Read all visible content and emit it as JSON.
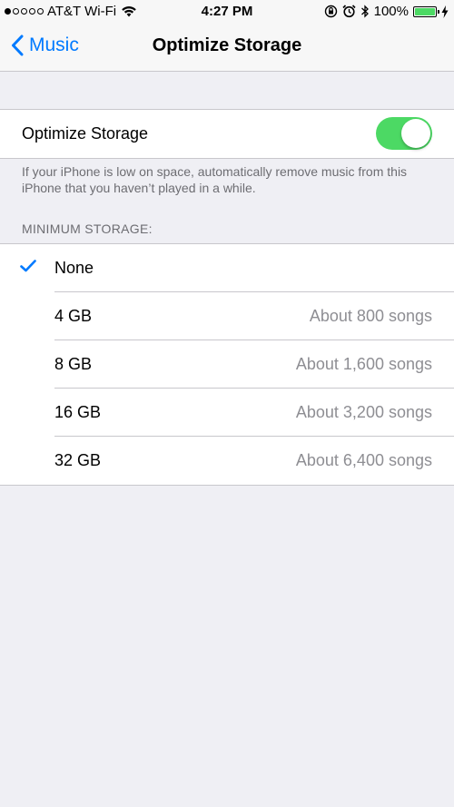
{
  "status_bar": {
    "carrier": "AT&T Wi-Fi",
    "time": "4:27 PM",
    "battery_percent": "100%",
    "battery_level": 1.0,
    "signal_bars_filled": 1,
    "signal_bars_total": 5
  },
  "nav": {
    "back_label": "Music",
    "title": "Optimize Storage"
  },
  "optimize_toggle": {
    "label": "Optimize Storage",
    "on": true
  },
  "description": "If your iPhone is low on space, automatically remove music from this iPhone that you haven’t played in a while.",
  "minimum_storage": {
    "header": "MINIMUM STORAGE:",
    "options": [
      {
        "label": "None",
        "detail": "",
        "selected": true
      },
      {
        "label": "4 GB",
        "detail": "About 800 songs",
        "selected": false
      },
      {
        "label": "8 GB",
        "detail": "About 1,600 songs",
        "selected": false
      },
      {
        "label": "16 GB",
        "detail": "About 3,200 songs",
        "selected": false
      },
      {
        "label": "32 GB",
        "detail": "About 6,400 songs",
        "selected": false
      }
    ]
  },
  "colors": {
    "accent": "#007aff",
    "switch_on": "#4cd964",
    "background": "#efeff4",
    "secondary_text": "#8e8e93"
  }
}
